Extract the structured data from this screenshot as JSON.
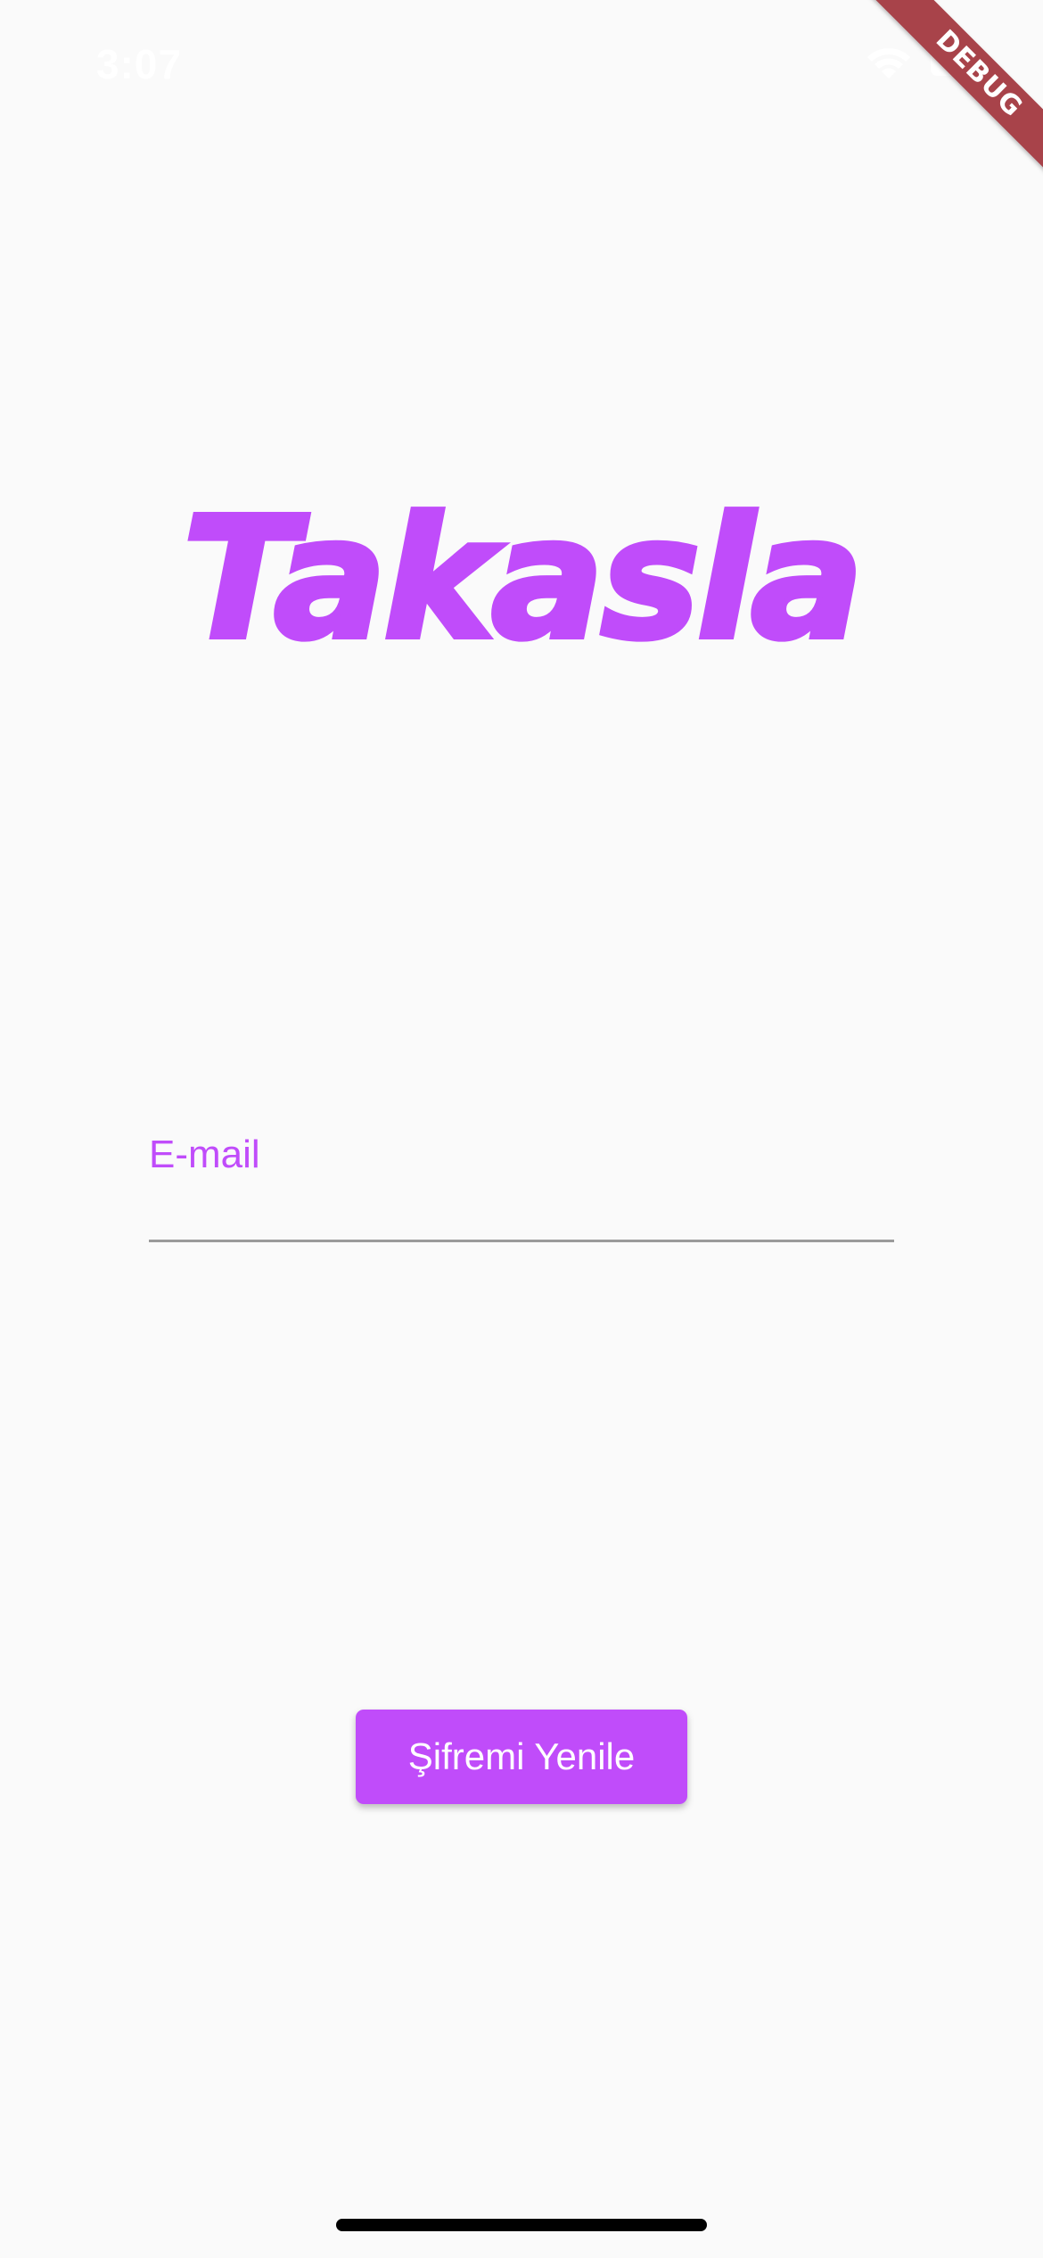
{
  "status_bar": {
    "time": "3:07",
    "wifi_icon": "wifi-icon",
    "battery_icon": "battery-icon"
  },
  "debug_banner": {
    "label": "DEBUG",
    "color": "#a8434a"
  },
  "logo": {
    "text": "Takasla"
  },
  "email_field": {
    "label": "E-mail",
    "value": ""
  },
  "reset_button": {
    "label": "Şifremi Yenile"
  },
  "colors": {
    "accent": "#c04cfa",
    "background": "#fafafa"
  }
}
